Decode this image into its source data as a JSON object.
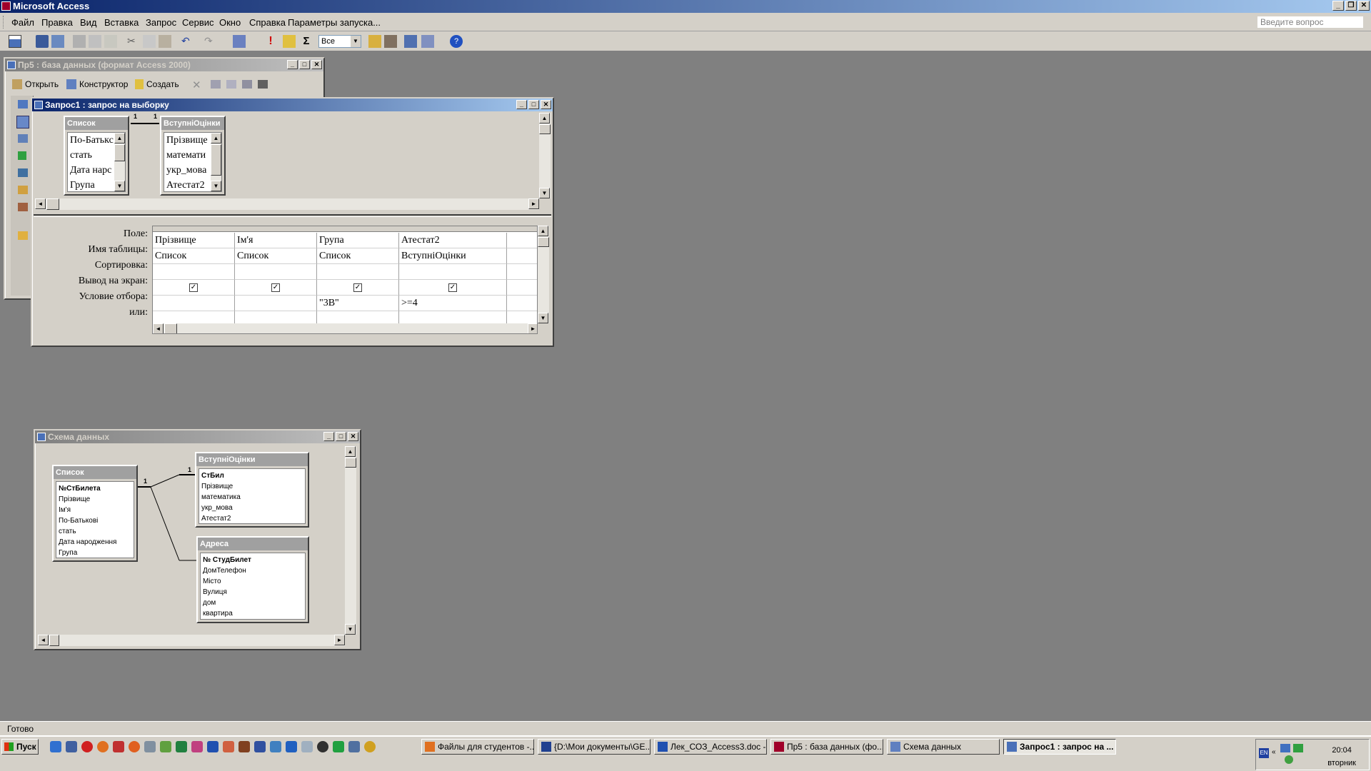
{
  "app": {
    "title": "Microsoft Access"
  },
  "menu": {
    "items": [
      "Файл",
      "Правка",
      "Вид",
      "Вставка",
      "Запрос",
      "Сервис",
      "Окно",
      "Справка",
      "Параметры запуска..."
    ],
    "ask_placeholder": "Введите вопрос"
  },
  "toolbar": {
    "filter_value": "Все"
  },
  "db_window": {
    "title": "Пр5 : база данных (формат Access 2000)",
    "open_label": "Открыть",
    "design_label": "Конструктор",
    "create_label": "Создать"
  },
  "query_window": {
    "title": "Запрос1 : запрос на выборку",
    "tables": [
      {
        "name": "Список",
        "fields": [
          "По-Батькс",
          "стать",
          "Дата нарс",
          "Група"
        ]
      },
      {
        "name": "ВступніОцінки",
        "fields": [
          "Прізвище",
          "математи",
          "укр_мова",
          "Атестат2"
        ]
      }
    ],
    "relation_labels": [
      "1",
      "1"
    ],
    "row_labels": [
      "Поле:",
      "Имя таблицы:",
      "Сортировка:",
      "Вывод на экран:",
      "Условие отбора:",
      "или:"
    ],
    "columns": [
      {
        "field": "Прізвище",
        "table": "Список",
        "sort": "",
        "show": true,
        "criteria": "",
        "or": ""
      },
      {
        "field": "Ім'я",
        "table": "Список",
        "sort": "",
        "show": true,
        "criteria": "",
        "or": ""
      },
      {
        "field": "Група",
        "table": "Список",
        "sort": "",
        "show": true,
        "criteria": "\"3В\"",
        "or": ""
      },
      {
        "field": "Атестат2",
        "table": "ВступніОцінки",
        "sort": "",
        "show": true,
        "criteria": ">=4",
        "or": ""
      }
    ]
  },
  "schema_window": {
    "title": "Схема данных",
    "tables": [
      {
        "name": "Список",
        "key": "№СтБилета",
        "fields": [
          "Прізвище",
          "Ім'я",
          "По-Батькові",
          "стать",
          "Дата народження",
          "Група"
        ]
      },
      {
        "name": "ВступніОцінки",
        "key": "СтБил",
        "fields": [
          "Прізвище",
          "математика",
          "укр_мова",
          "Атестат2"
        ]
      },
      {
        "name": "Адреса",
        "key": "№ СтудБилет",
        "fields": [
          "ДомТелефон",
          "Місто",
          "Вулиця",
          "дом",
          "квартира"
        ]
      }
    ],
    "relation_labels": [
      "1",
      "1"
    ]
  },
  "status": {
    "text": "Готово"
  },
  "taskbar": {
    "start_label": "Пуск",
    "tasks": [
      "Файлы для студентов -...",
      "{D:\\Мои документы\\GE...",
      "Лек_СОЗ_Access3.doc -...",
      "Пр5 : база данных (фо...",
      "Схема данных",
      "Запрос1 : запрос на ..."
    ],
    "lang": "EN",
    "time": "20:04",
    "day": "вторник"
  },
  "colors": {
    "title_active": "#0a246a",
    "title_gradient_end": "#a6caf0",
    "desktop": "#808080",
    "face": "#d4d0c8"
  }
}
